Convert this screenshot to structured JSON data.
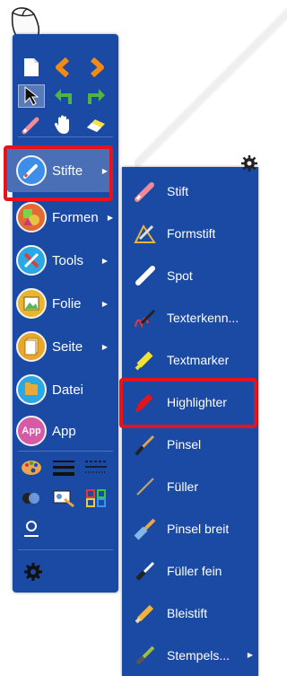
{
  "toolbar": {
    "menu": [
      {
        "key": "stifte",
        "label": "Stifte",
        "has_submenu": true
      },
      {
        "key": "formen",
        "label": "Formen",
        "has_submenu": true
      },
      {
        "key": "tools",
        "label": "Tools",
        "has_submenu": true
      },
      {
        "key": "folie",
        "label": "Folie",
        "has_submenu": true
      },
      {
        "key": "seite",
        "label": "Seite",
        "has_submenu": true
      },
      {
        "key": "datei",
        "label": "Datei",
        "has_submenu": false
      },
      {
        "key": "app",
        "label": "App",
        "has_submenu": false
      }
    ],
    "app_icon_text": "App"
  },
  "submenu": {
    "items": [
      {
        "label": "Stift",
        "icon": "pen-icon"
      },
      {
        "label": "Formstift",
        "icon": "shape-pen-icon"
      },
      {
        "label": "Spot",
        "icon": "spot-icon"
      },
      {
        "label": "Texterkenn...",
        "icon": "text-recognition-icon"
      },
      {
        "label": "Textmarker",
        "icon": "text-marker-icon"
      },
      {
        "label": "Highlighter",
        "icon": "highlighter-icon"
      },
      {
        "label": "Pinsel",
        "icon": "brush-icon"
      },
      {
        "label": "Füller",
        "icon": "fountain-pen-icon"
      },
      {
        "label": "Pinsel breit",
        "icon": "wide-brush-icon"
      },
      {
        "label": "Füller fein",
        "icon": "fine-fountain-pen-icon"
      },
      {
        "label": "Bleistift",
        "icon": "pencil-icon"
      },
      {
        "label": "Stempels...",
        "icon": "stamp-pen-icon",
        "has_submenu": true
      }
    ]
  },
  "colors": {
    "toolbar_bg": "#1a4aa3",
    "highlight_border": "#e8121c",
    "selected_bg": "#4a6fb7"
  }
}
